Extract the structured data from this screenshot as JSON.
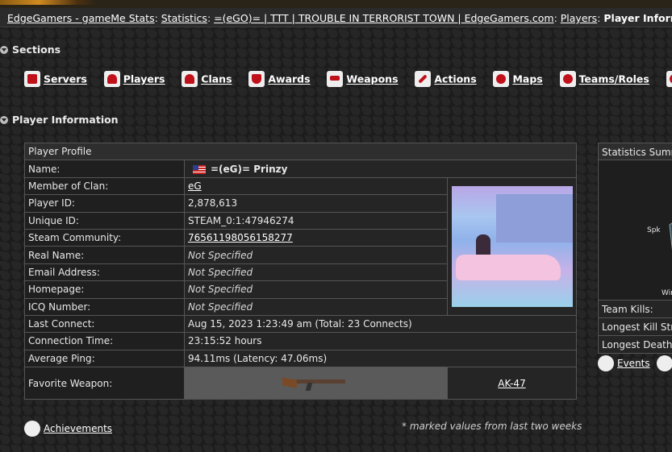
{
  "breadcrumb": {
    "site": "EdgeGamers - gameMe Stats",
    "statistics": "Statistics",
    "game": "=(eGO)= | TTT | TROUBLE IN TERRORIST TOWN | EdgeGamers.com",
    "players": "Players",
    "current": "Player Information"
  },
  "sections_header": "Sections",
  "nav": [
    {
      "label": "Servers",
      "icon": "server-icon"
    },
    {
      "label": "Players",
      "icon": "player-icon"
    },
    {
      "label": "Clans",
      "icon": "clan-icon"
    },
    {
      "label": "Awards",
      "icon": "trophy-icon"
    },
    {
      "label": "Weapons",
      "icon": "gun-icon"
    },
    {
      "label": "Actions",
      "icon": "wrench-icon"
    },
    {
      "label": "Maps",
      "icon": "crosshair-icon"
    },
    {
      "label": "Teams/Roles",
      "icon": "refresh-icon"
    }
  ],
  "player_info_header": "Player Information",
  "profile": {
    "title": "Player Profile",
    "rows": [
      {
        "label": "Name:",
        "value": "=(eG)= Prinzy"
      },
      {
        "label": "Member of Clan:",
        "value": "eG"
      },
      {
        "label": "Player ID:",
        "value": "2,878,613"
      },
      {
        "label": "Unique ID:",
        "value": "STEAM_0:1:47946274"
      },
      {
        "label": "Steam Community:",
        "value": "76561198056158277"
      },
      {
        "label": "Real Name:",
        "value": "Not Specified"
      },
      {
        "label": "Email Address:",
        "value": "Not Specified"
      },
      {
        "label": "Homepage:",
        "value": "Not Specified"
      },
      {
        "label": "ICQ Number:",
        "value": "Not Specified"
      },
      {
        "label": "Last Connect:",
        "value": "Aug 15, 2023 1:23:49 am (Total: 23 Connects)"
      },
      {
        "label": "Connection Time:",
        "value": "23:15:52 hours"
      },
      {
        "label": "Average Ping:",
        "value": "94.11ms (Latency: 47.06ms)"
      },
      {
        "label": "Favorite Weapon:",
        "value": "AK-47"
      }
    ]
  },
  "note": "* marked values from last two weeks",
  "achievements_label": "Achievements",
  "stats": {
    "title": "Statistics Summ",
    "graph_labels": [
      "Spk",
      "Win"
    ],
    "rows": [
      "Team Kills:",
      "Longest Kill Str",
      "Longest Death"
    ]
  },
  "links": {
    "events": "Events"
  }
}
